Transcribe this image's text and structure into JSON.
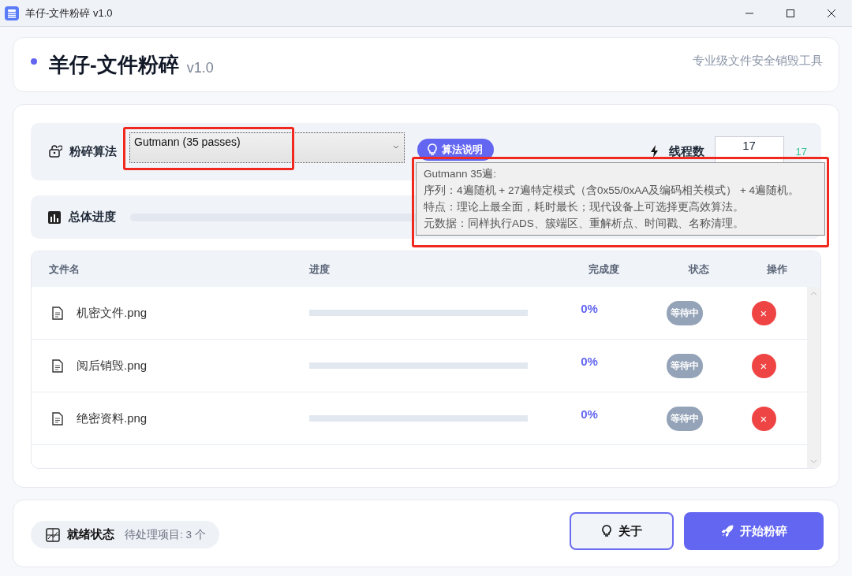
{
  "window": {
    "title": "羊仔-文件粉碎 v1.0"
  },
  "header": {
    "title": "羊仔-文件粉碎",
    "version": "v1.0",
    "subtitle": "专业级文件安全销毁工具"
  },
  "algorithm": {
    "label": "粉碎算法",
    "value": "Gutmann (35 passes)",
    "highlighted": true
  },
  "info_button": {
    "label": "算法说明"
  },
  "threads": {
    "label": "线程数",
    "value": "17",
    "reading": "17"
  },
  "tooltip": {
    "highlighted": true,
    "lines": [
      "Gutmann 35遍:",
      "序列：4遍随机 + 27遍特定模式（含0x55/0xAA及编码相关模式） + 4遍随机。",
      "特点：理论上最全面，耗时最长；现代设备上可选择更高效算法。",
      "元数据：同样执行ADS、簇端区、重解析点、时间戳、名称清理。"
    ]
  },
  "overall_progress": {
    "label": "总体进度",
    "level": 0
  },
  "table": {
    "columns": [
      "文件名",
      "进度",
      "完成度",
      "状态",
      "操作"
    ],
    "rows": [
      {
        "name": "机密文件.png",
        "level": 0,
        "percent": "0%",
        "status": "等待中",
        "remove": "×"
      },
      {
        "name": "阅后销毁.png",
        "level": 0,
        "percent": "0%",
        "status": "等待中",
        "remove": "×"
      },
      {
        "name": "绝密资料.png",
        "level": 0,
        "percent": "0%",
        "status": "等待中",
        "remove": "×"
      }
    ]
  },
  "status_bar": {
    "label": "就绪状态",
    "pending": "待处理项目: 3 个"
  },
  "buttons": [
    {
      "label": "关于",
      "kind": "secondary"
    },
    {
      "label": "开始粉碎",
      "kind": "primary"
    }
  ]
}
